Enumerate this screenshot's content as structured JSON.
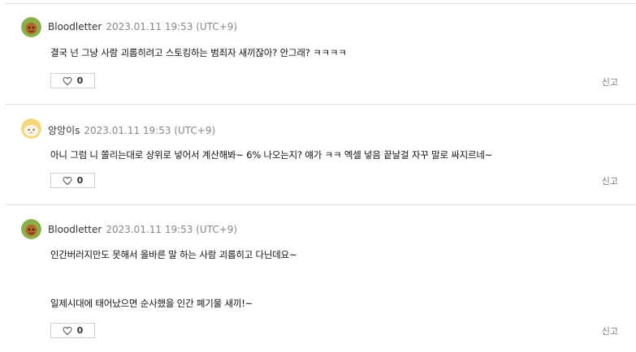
{
  "comments": [
    {
      "nickname": "Bloodletter",
      "timestamp": "2023.01.11 19:53 (UTC+9)",
      "avatar": "orange-ball-avatar",
      "lines": [
        "결국 넌 그냥 사람 괴롭히려고 스토킹하는 범죄자 새끼잖아? 안그래? ㅋㅋㅋㅋ"
      ],
      "likes": "0",
      "report_label": "신고"
    },
    {
      "nickname": "앙앙이s",
      "timestamp": "2023.01.11 19:53 (UTC+9)",
      "avatar": "yellow-face-avatar",
      "lines": [
        "아니 그럼 니 쫄리는대로 상위로 넣어서 계산해봐~ 6% 나오는지? 얘가 ㅋㅋ 엑셀 넣음 끝날걸 자꾸 말로 싸지르네~"
      ],
      "likes": "0",
      "report_label": "신고"
    },
    {
      "nickname": "Bloodletter",
      "timestamp": "2023.01.11 19:53 (UTC+9)",
      "avatar": "orange-ball-avatar",
      "lines": [
        "인간버러지만도 못해서 올바른 말 하는 사람 괴롭히고 다닌데요~",
        "일제시대에 태어났으면 순사했을 인간 폐기물 새끼!~"
      ],
      "likes": "0",
      "report_label": "신고"
    }
  ],
  "colors": {
    "divider": "#e2e2e2",
    "meta_gray": "#888888",
    "avatar_orange_bg": "#8bb04a",
    "avatar_yellow_bg": "#f3d77a"
  },
  "icons": {
    "like": "heart-outline-icon"
  }
}
